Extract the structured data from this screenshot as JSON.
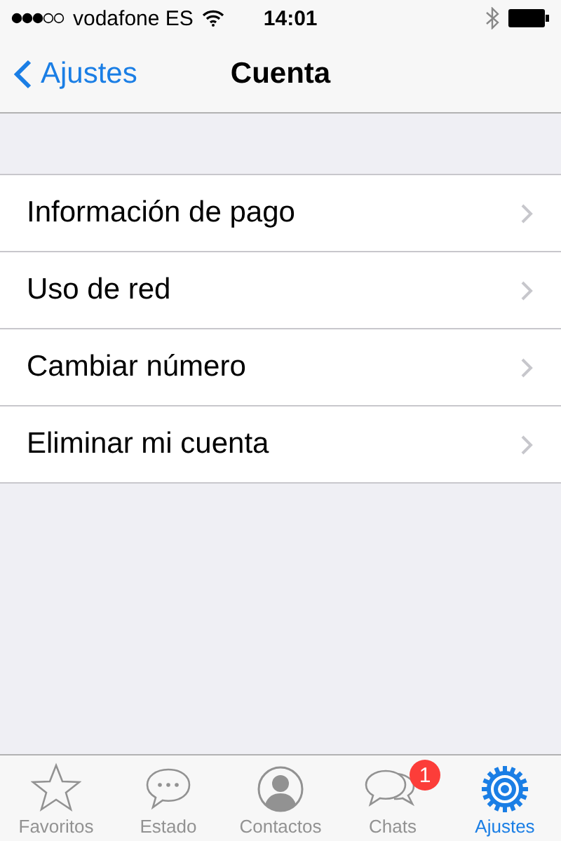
{
  "status_bar": {
    "carrier": "vodafone ES",
    "time": "14:01"
  },
  "nav": {
    "back": "Ajustes",
    "title": "Cuenta"
  },
  "items": [
    {
      "label": "Información de pago"
    },
    {
      "label": "Uso de red"
    },
    {
      "label": "Cambiar número"
    },
    {
      "label": "Eliminar mi cuenta"
    }
  ],
  "tabs": [
    {
      "label": "Favoritos",
      "selected": false
    },
    {
      "label": "Estado",
      "selected": false
    },
    {
      "label": "Contactos",
      "selected": false
    },
    {
      "label": "Chats",
      "selected": false,
      "badge": "1"
    },
    {
      "label": "Ajustes",
      "selected": true
    }
  ]
}
